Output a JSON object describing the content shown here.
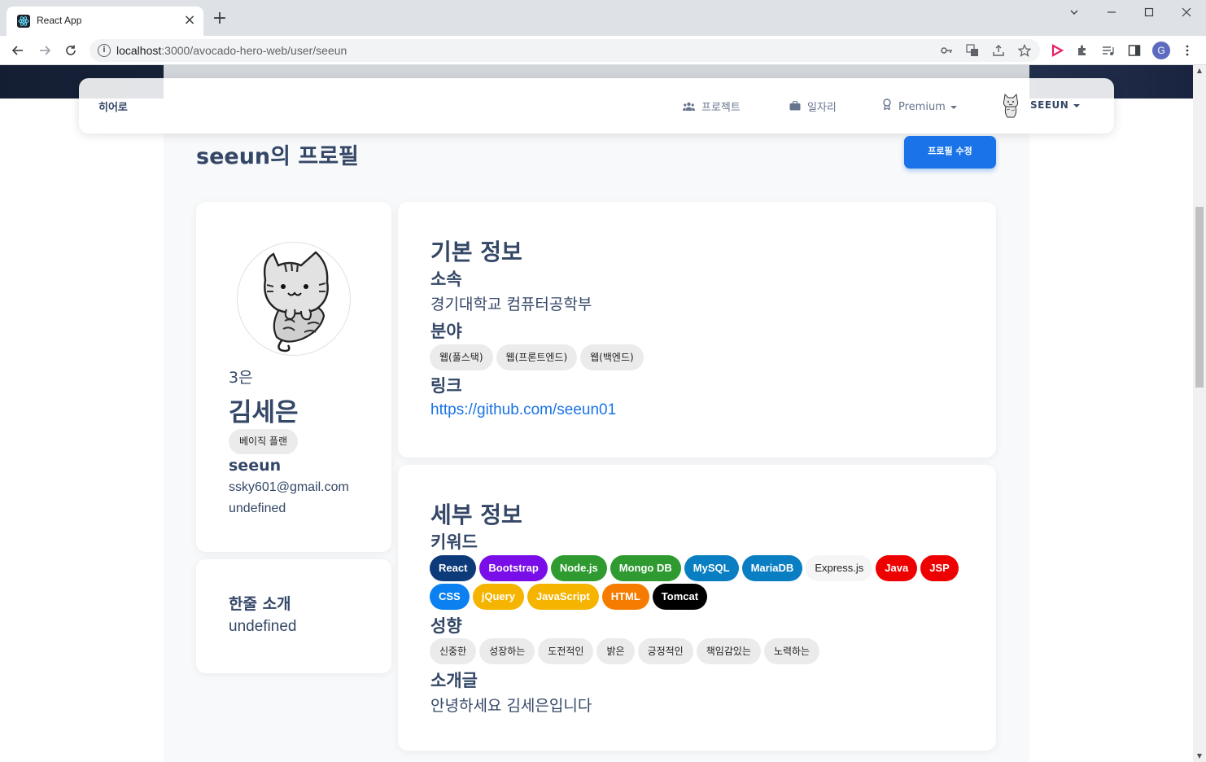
{
  "browser": {
    "tab_title": "React App",
    "tab_close": "×",
    "new_tab": "+",
    "url_host": "localhost",
    "url_path": ":3000/avocado-hero-web/user/seeun",
    "profile_initial": "G"
  },
  "navbar": {
    "brand": "히어로",
    "items": [
      {
        "label": "프로젝트",
        "icon": "users-icon"
      },
      {
        "label": "일자리",
        "icon": "briefcase-icon"
      },
      {
        "label": "Premium",
        "icon": "badge-icon"
      }
    ],
    "user": "SEEUN"
  },
  "page": {
    "title": "seeun의 프로필",
    "edit_button": "프로필 수정"
  },
  "profile_card": {
    "grade": "3은",
    "real_name": "김세은",
    "plan": "베이직 플랜",
    "username": "seeun",
    "email": "ssky601@gmail.com",
    "extra": "undefined"
  },
  "intro_card": {
    "title": "한줄 소개",
    "text": "undefined"
  },
  "basic_info": {
    "title": "기본 정보",
    "affiliation_label": "소속",
    "affiliation": "경기대학교 컴퓨터공학부",
    "field_label": "분야",
    "fields": [
      "웹(풀스택)",
      "웹(프론트엔드)",
      "웹(백엔드)"
    ],
    "link_label": "링크",
    "link": "https://github.com/seeun01"
  },
  "detail_info": {
    "title": "세부 정보",
    "keywords_label": "키워드",
    "keywords": [
      {
        "label": "React",
        "color": "#0d3b7a"
      },
      {
        "label": "Bootstrap",
        "color": "#7a0ee8"
      },
      {
        "label": "Node.js",
        "color": "#2e9a30"
      },
      {
        "label": "Mongo DB",
        "color": "#2e9a30"
      },
      {
        "label": "MySQL",
        "color": "#0a7ec2"
      },
      {
        "label": "MariaDB",
        "color": "#0a7ec2"
      },
      {
        "label": "Express.js",
        "color": "#f5f5f5"
      },
      {
        "label": "Java",
        "color": "#ee0000"
      },
      {
        "label": "JSP",
        "color": "#ee0000"
      },
      {
        "label": "CSS",
        "color": "#0b80f0"
      },
      {
        "label": "jQuery",
        "color": "#f5b400"
      },
      {
        "label": "JavaScript",
        "color": "#f5b400"
      },
      {
        "label": "HTML",
        "color": "#f57c00"
      },
      {
        "label": "Tomcat",
        "color": "#000000"
      }
    ],
    "traits_label": "성향",
    "traits": [
      "신중한",
      "성장하는",
      "도전적인",
      "밝은",
      "긍정적인",
      "책임감있는",
      "노력하는"
    ],
    "bio_label": "소개글",
    "bio": "안녕하세요 김세은입니다"
  }
}
